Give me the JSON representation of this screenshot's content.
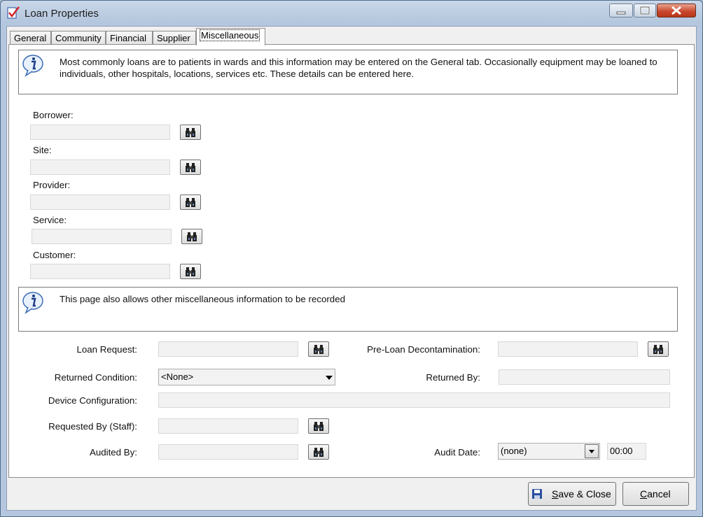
{
  "window": {
    "title": "Loan Properties"
  },
  "tabs": [
    {
      "label": "General",
      "active": false
    },
    {
      "label": "Community",
      "active": false
    },
    {
      "label": "Financial",
      "active": false
    },
    {
      "label": "Supplier",
      "active": false
    },
    {
      "label": "Miscellaneous",
      "active": true
    }
  ],
  "info_top": {
    "text": "Most commonly loans are to patients in wards and this information may be entered on the General tab. Occasionally equipment may be loaned to individuals, other hospitals, locations, services etc. These details can be entered here."
  },
  "lookups": {
    "borrower": {
      "label": "Borrower:",
      "value": ""
    },
    "site": {
      "label": "Site:",
      "value": ""
    },
    "provider": {
      "label": "Provider:",
      "value": ""
    },
    "service": {
      "label": "Service:",
      "value": ""
    },
    "customer": {
      "label": "Customer:",
      "value": ""
    }
  },
  "info_misc": {
    "text": "This page also allows other miscellaneous information to be recorded"
  },
  "misc": {
    "loan_request": {
      "label": "Loan Request:",
      "value": ""
    },
    "pre_loan_decontamination": {
      "label": "Pre-Loan Decontamination:",
      "value": ""
    },
    "returned_condition": {
      "label": "Returned Condition:",
      "value": "<None>"
    },
    "returned_by": {
      "label": "Returned By:",
      "value": ""
    },
    "device_configuration": {
      "label": "Device Configuration:",
      "value": ""
    },
    "requested_by": {
      "label": "Requested By (Staff):",
      "value": ""
    },
    "audited_by": {
      "label": "Audited By:",
      "value": ""
    },
    "audit_date": {
      "label": "Audit Date:",
      "date": "(none)",
      "time": "00:00"
    }
  },
  "footer": {
    "save_close": "Save & Close",
    "cancel": "Cancel"
  },
  "icons": {
    "find": "binoculars-icon",
    "info": "info-icon",
    "save": "floppy-disk-icon",
    "app": "checklist-icon"
  }
}
